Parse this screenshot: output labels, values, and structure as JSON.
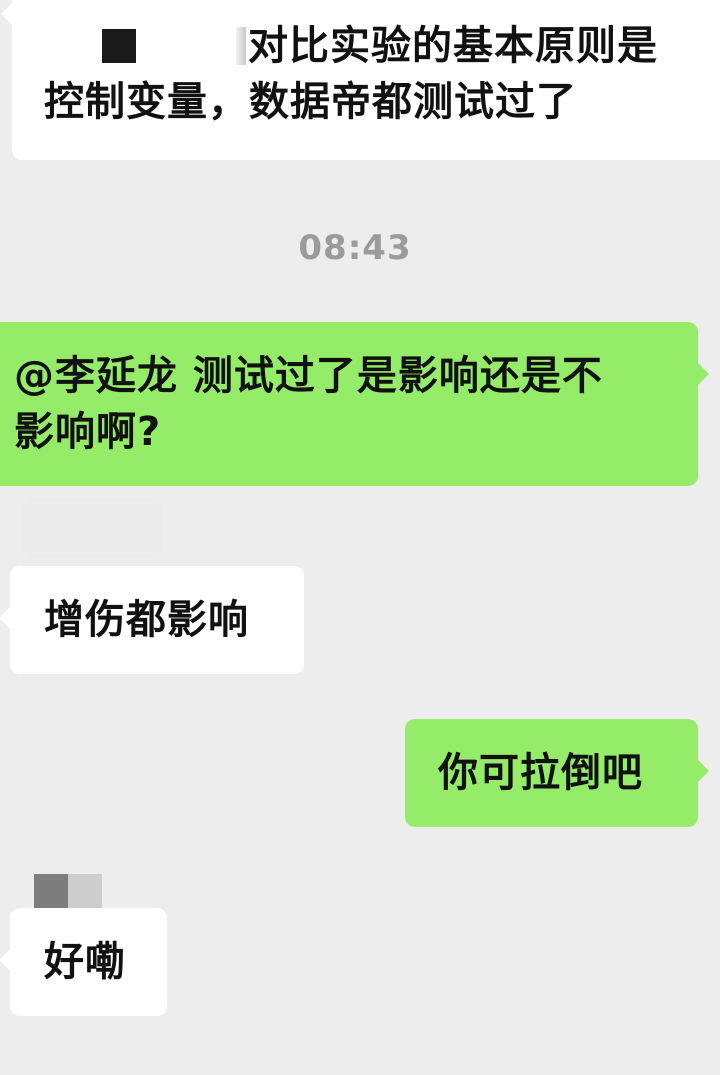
{
  "conversation": {
    "messages": [
      {
        "side": "left",
        "line1_text": "对比实验的基本原则是",
        "line2_text": "控制变量，数据帝都测试过了"
      },
      {
        "timestamp": "08:43"
      },
      {
        "side": "right",
        "line1_text": "@李延龙 测试过了是影响还是不",
        "line2_text": "影响啊?"
      },
      {
        "side": "left",
        "text": "增伤都影响"
      },
      {
        "side": "right",
        "text": "你可拉倒吧"
      },
      {
        "side": "left",
        "text": "好嘞"
      }
    ]
  },
  "colors": {
    "background": "#ededed",
    "incoming_bubble": "#ffffff",
    "outgoing_bubble": "#95ec69",
    "timestamp_text": "#9b9b9b",
    "message_text": "#111111"
  }
}
